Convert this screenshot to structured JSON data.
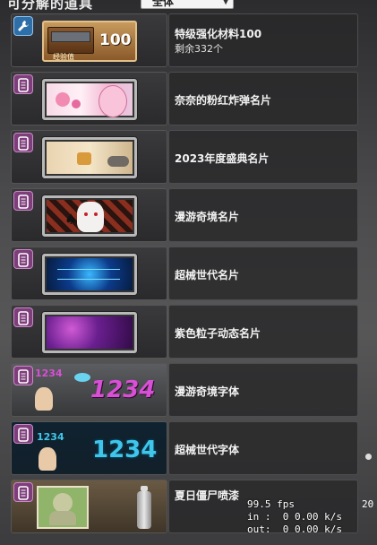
{
  "header": {
    "title": "可分解的道具",
    "filter_value": "全体"
  },
  "items": [
    {
      "name": "特级强化材料100",
      "sub": "剩余332个",
      "badge": "wrench-icon",
      "thumb_text": "100",
      "thumb_small": "经验值"
    },
    {
      "name": "奈奈的粉红炸弹名片",
      "sub": "",
      "badge": "card-icon"
    },
    {
      "name": "2023年度盛典名片",
      "sub": "",
      "badge": "card-icon"
    },
    {
      "name": "漫游奇境名片",
      "sub": "",
      "badge": "card-icon"
    },
    {
      "name": "超械世代名片",
      "sub": "",
      "badge": "card-icon"
    },
    {
      "name": "紫色粒子动态名片",
      "sub": "",
      "badge": "card-icon"
    },
    {
      "name": "漫游奇境字体",
      "sub": "",
      "badge": "card-icon",
      "font_sample": "1234"
    },
    {
      "name": "超械世代字体",
      "sub": "",
      "badge": "card-icon",
      "font_sample": "1234"
    },
    {
      "name": "夏日僵尸喷漆",
      "sub": "",
      "badge": "card-icon"
    }
  ],
  "overlay": {
    "fps": "99.5 fps",
    "in": "in :  0 0.00 k/s",
    "out": "out:  0 0.00 k/s",
    "right_partial": "20"
  },
  "colors": {
    "badge_pink": "#7e3d7b",
    "badge_blue": "#2f6fa8",
    "font_pink": "#d94fd6",
    "font_cyan": "#3fc6ea"
  }
}
